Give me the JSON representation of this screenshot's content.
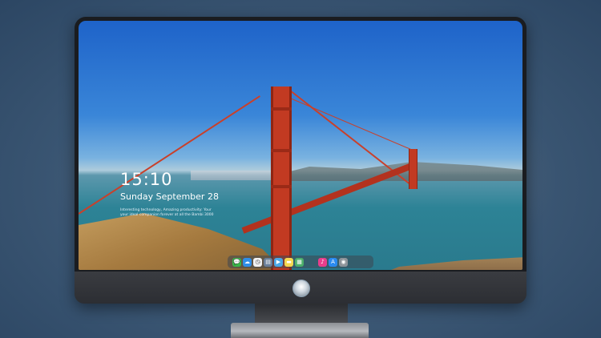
{
  "lockscreen": {
    "time": "15:10",
    "date": "Sunday September 28",
    "message_line1": "Interesting technology, Amazing productivity: Your",
    "message_line2": "your ideal companion forever at all the Bambi 3000"
  },
  "dock": {
    "apps": [
      {
        "name": "messages-icon",
        "glyph": "💬",
        "color": "#39b54a"
      },
      {
        "name": "finder-icon",
        "glyph": "☁",
        "color": "#2f8ee8"
      },
      {
        "name": "clock-icon",
        "glyph": "◷",
        "color": "#f2f2f2"
      },
      {
        "name": "files-icon",
        "glyph": "▤",
        "color": "#6a7f99"
      },
      {
        "name": "video-icon",
        "glyph": "▶",
        "color": "#4aa7e8"
      },
      {
        "name": "notes-icon",
        "glyph": "▬",
        "color": "#f4d84f"
      },
      {
        "name": "gallery-icon",
        "glyph": "▦",
        "color": "#4caf6a"
      },
      {
        "name": "music-icon",
        "glyph": "♪",
        "color": "#e83e8c"
      },
      {
        "name": "appstore-icon",
        "glyph": "A",
        "color": "#2a8af0"
      },
      {
        "name": "camera-icon",
        "glyph": "◉",
        "color": "#8e949a"
      }
    ]
  },
  "colors": {
    "bridge_red": "#c23a22",
    "sky_blue": "#1e63c9",
    "bezel": "#1a1c20"
  }
}
